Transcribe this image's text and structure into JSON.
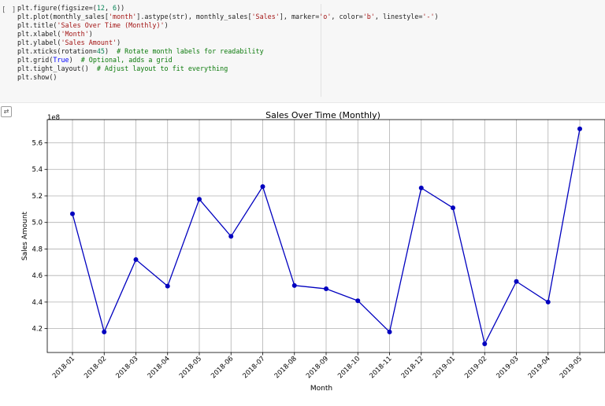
{
  "cell": {
    "run_indicator": "[ ]",
    "output_toggle_icon": "output-toggle-icon",
    "code_lines": [
      [
        {
          "t": "plt.figure(figsize=("
        },
        {
          "t": "12",
          "c": "num"
        },
        {
          "t": ", "
        },
        {
          "t": "6",
          "c": "num"
        },
        {
          "t": "))"
        }
      ],
      [
        {
          "t": "plt.plot(monthly_sales["
        },
        {
          "t": "'month'",
          "c": "str"
        },
        {
          "t": "].astype(str), monthly_sales["
        },
        {
          "t": "'Sales'",
          "c": "str"
        },
        {
          "t": "], marker="
        },
        {
          "t": "'o'",
          "c": "str"
        },
        {
          "t": ", color="
        },
        {
          "t": "'b'",
          "c": "str"
        },
        {
          "t": ", linestyle="
        },
        {
          "t": "'-'",
          "c": "str"
        },
        {
          "t": ")"
        }
      ],
      [
        {
          "t": "plt.title("
        },
        {
          "t": "'Sales Over Time (Monthly)'",
          "c": "str"
        },
        {
          "t": ")"
        }
      ],
      [
        {
          "t": "plt.xlabel("
        },
        {
          "t": "'Month'",
          "c": "str"
        },
        {
          "t": ")"
        }
      ],
      [
        {
          "t": "plt.ylabel("
        },
        {
          "t": "'Sales Amount'",
          "c": "str"
        },
        {
          "t": ")"
        }
      ],
      [
        {
          "t": "plt.xticks(rotation="
        },
        {
          "t": "45",
          "c": "num"
        },
        {
          "t": ")  "
        },
        {
          "t": "# Rotate month labels for readability",
          "c": "comment"
        }
      ],
      [
        {
          "t": "plt.grid("
        },
        {
          "t": "True",
          "c": "kw"
        },
        {
          "t": ")  "
        },
        {
          "t": "# Optional, adds a grid",
          "c": "comment"
        }
      ],
      [
        {
          "t": "plt.tight_layout()  "
        },
        {
          "t": "# Adjust layout to fit everything",
          "c": "comment"
        }
      ],
      [
        {
          "t": "plt.show()"
        }
      ]
    ]
  },
  "chart_data": {
    "type": "line",
    "title": "Sales Over Time (Monthly)",
    "xlabel": "Month",
    "ylabel": "Sales Amount",
    "y_offset_label": "1e8",
    "categories": [
      "2018-01",
      "2018-02",
      "2018-03",
      "2018-04",
      "2018-05",
      "2018-06",
      "2018-07",
      "2018-08",
      "2018-09",
      "2018-10",
      "2018-11",
      "2018-12",
      "2019-01",
      "2019-02",
      "2019-03",
      "2019-04",
      "2019-05"
    ],
    "series": [
      {
        "values": [
          5.065,
          4.175,
          4.72,
          4.52,
          5.175,
          4.895,
          5.27,
          4.525,
          4.5,
          4.41,
          4.175,
          5.26,
          5.11,
          4.085,
          4.555,
          4.4,
          5.705
        ]
      }
    ],
    "y_unit_multiplier": 100000000,
    "ylim": [
      4.02,
      5.775
    ],
    "yticks": [
      4.2,
      4.4,
      4.6,
      4.8,
      5.0,
      5.2,
      5.4,
      5.6
    ],
    "ytick_labels": [
      "4.2",
      "4.4",
      "4.6",
      "4.8",
      "5.0",
      "5.2",
      "5.4",
      "5.6"
    ],
    "grid": true,
    "line_color": "#0000bf",
    "marker_color": "#0000bf",
    "marker": "circle",
    "tick_rotation": 45
  }
}
